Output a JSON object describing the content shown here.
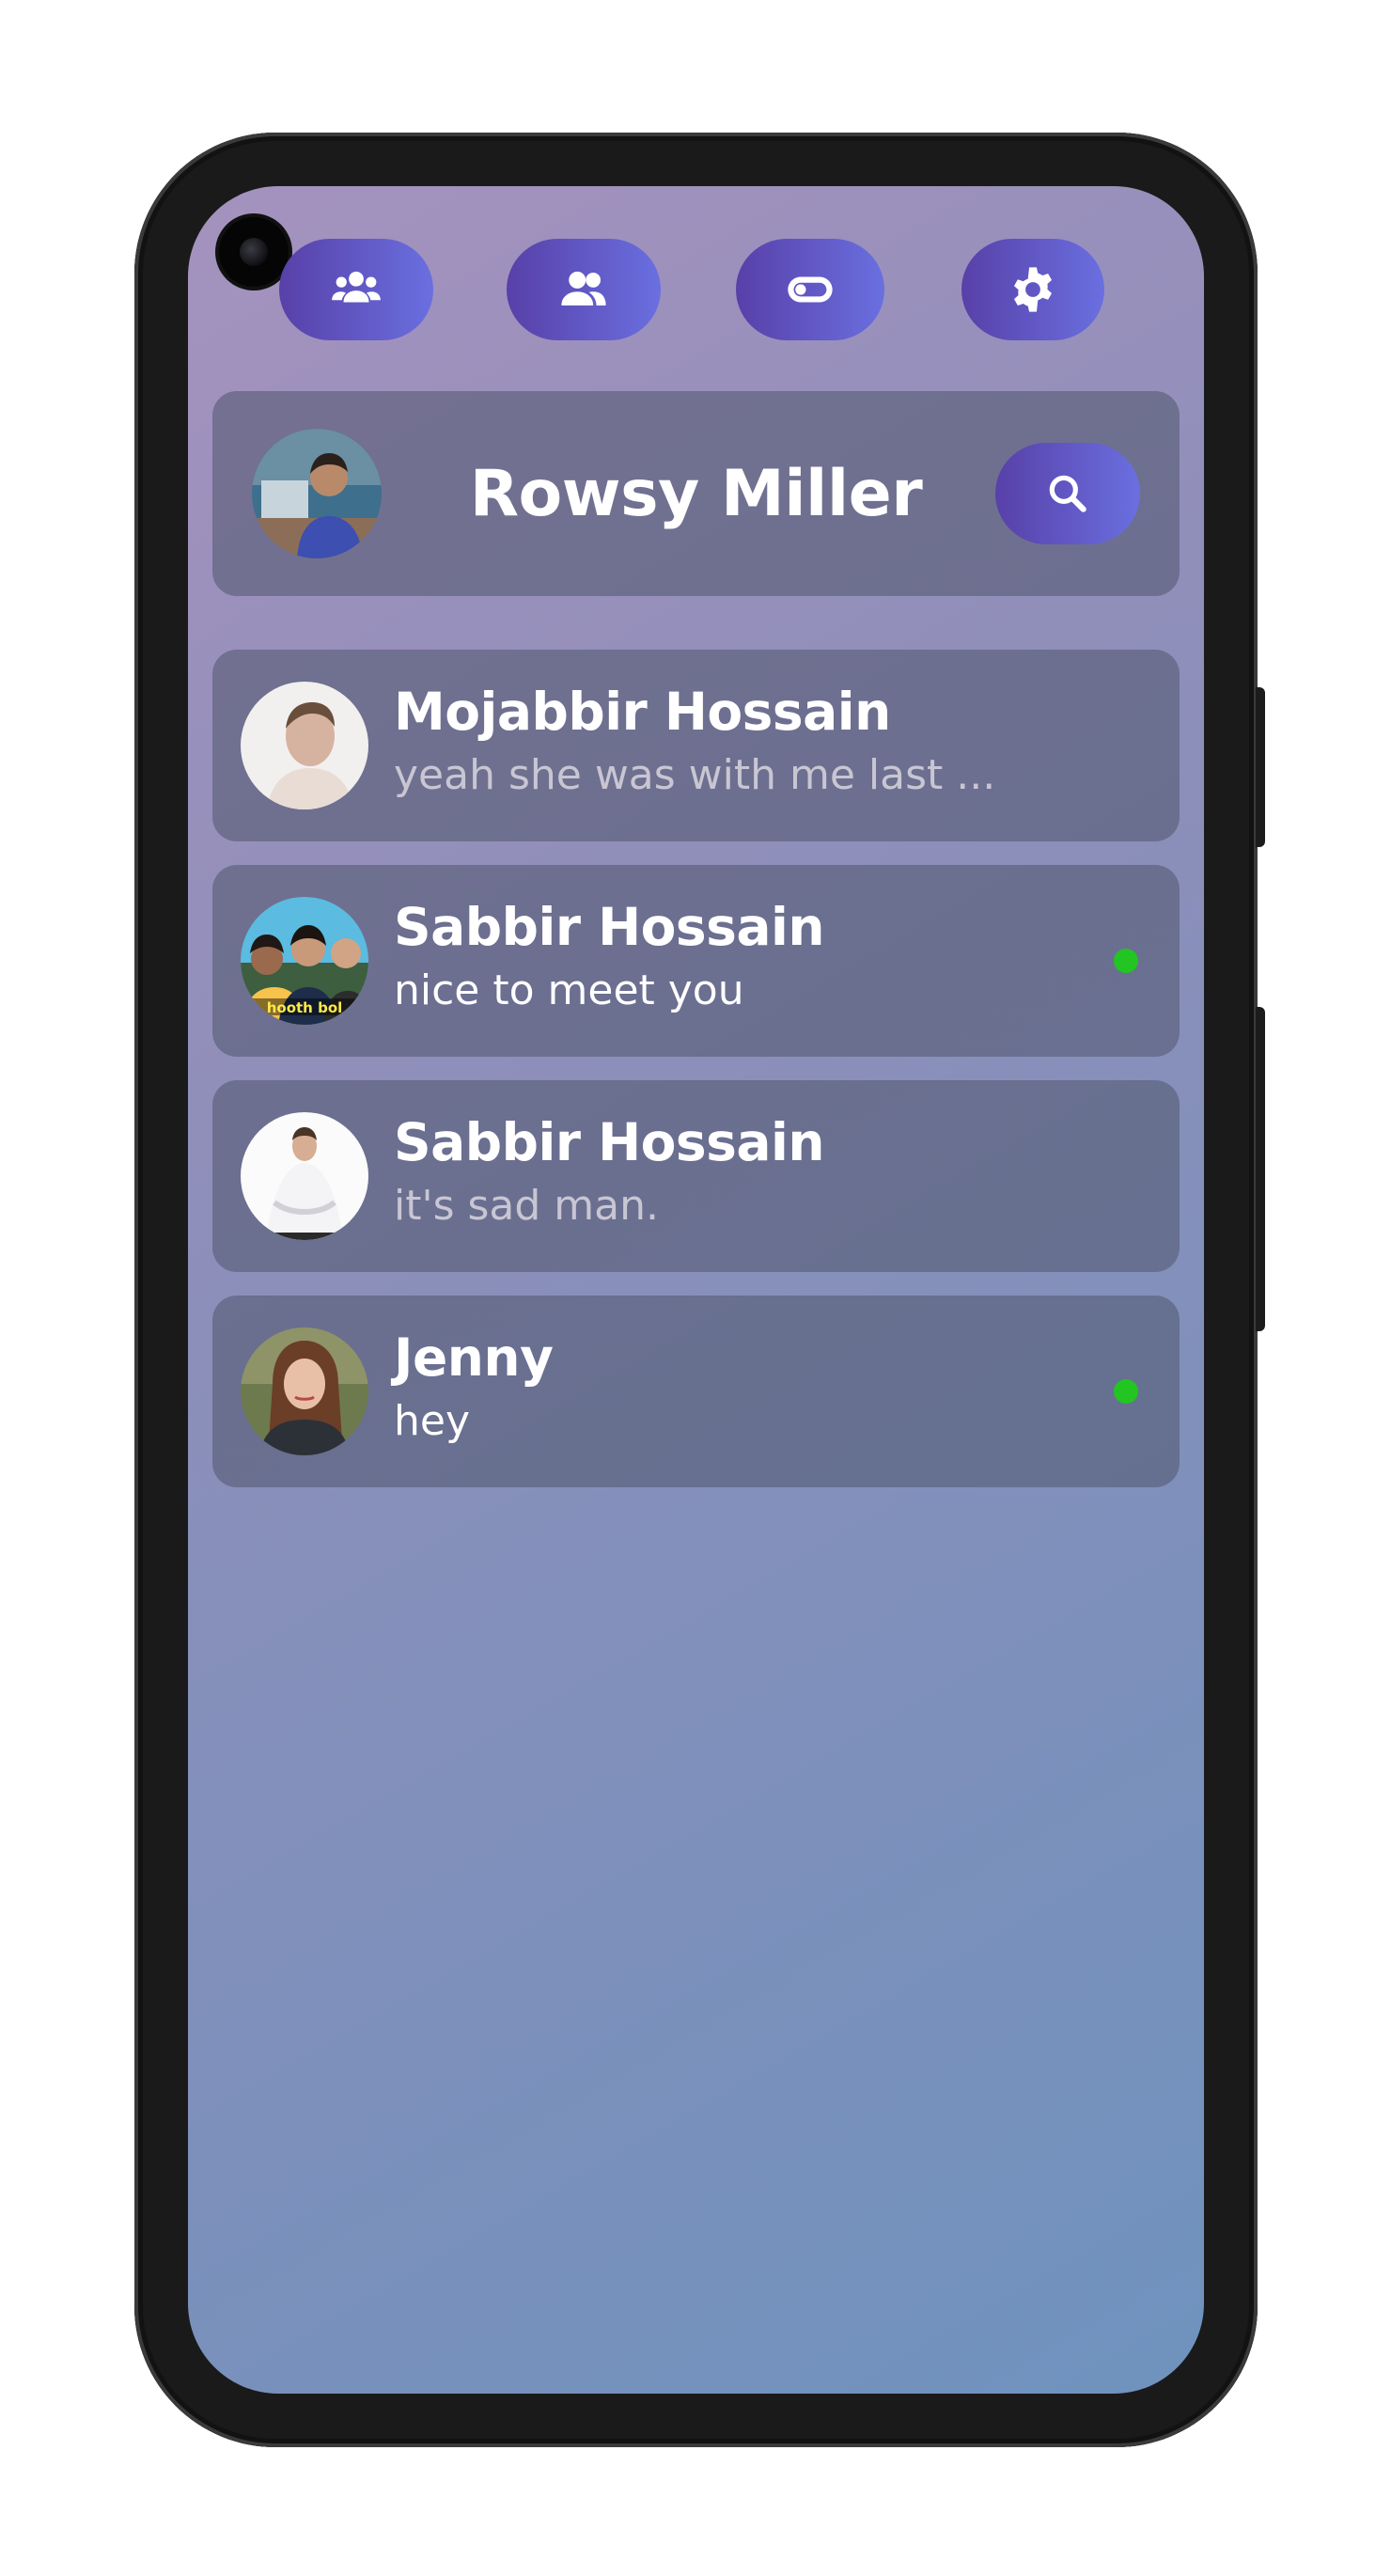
{
  "top_nav": [
    {
      "name": "groups-icon"
    },
    {
      "name": "friends-icon"
    },
    {
      "name": "toggle-icon"
    },
    {
      "name": "settings-icon"
    }
  ],
  "profile": {
    "name": "Rowsy Miller",
    "avatar": "user-avatar-photo"
  },
  "colors": {
    "accent_gradient_start": "#5840a8",
    "accent_gradient_end": "#6a6fe0",
    "online_dot": "#22c522",
    "card_background": "#50556e"
  },
  "chats": [
    {
      "name": "Mojabbir Hossain",
      "message": "yeah she was with me last ...",
      "online": false,
      "read": true
    },
    {
      "name": "Sabbir Hossain",
      "message": "nice to meet you",
      "online": true,
      "read": false
    },
    {
      "name": "Sabbir Hossain",
      "message": "it's sad man.",
      "online": false,
      "read": true
    },
    {
      "name": "Jenny",
      "message": "hey",
      "online": true,
      "read": false
    }
  ]
}
